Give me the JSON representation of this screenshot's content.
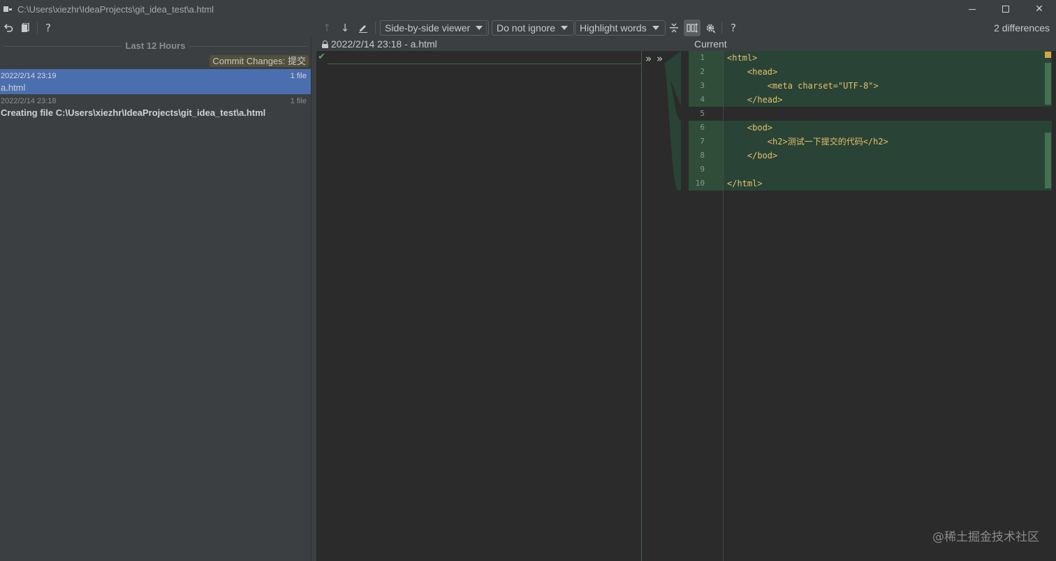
{
  "window": {
    "title": "C:\\Users\\xiezhr\\IdeaProjects\\git_idea_test\\a.html",
    "minimize": "",
    "maximize": "",
    "close": "✕"
  },
  "toolbar": {
    "revert_icon": "arrow-undo-icon",
    "history_icon": "document-icon",
    "help_label": "?",
    "prev_diff_icon": "↑",
    "next_diff_icon": "↓",
    "edit_icon": "pencil-icon",
    "viewer_label": "Side-by-side viewer",
    "ignore_label": "Do not ignore",
    "highlight_label": "Highlight words",
    "collapse_icon": "collapse-unchanged-icon",
    "sync_scroll_icon": "sync-scroll-icon",
    "settings_icon": "gear-icon",
    "help2_label": "?",
    "differences": "2 differences"
  },
  "history": {
    "group_title": "Last 12 Hours",
    "tag": "Commit Changes: 提交",
    "revisions": [
      {
        "date": "2022/2/14 23:19",
        "count": "1 file",
        "message": "a.html",
        "selected": true
      },
      {
        "date": "2022/2/14 23:18",
        "count": "1 file",
        "message": "Creating file C:\\Users\\xiezhr\\IdeaProjects\\git_idea_test\\a.html",
        "selected": false
      }
    ]
  },
  "diff": {
    "left_title": "2022/2/14 23:18 - a.html",
    "right_title": "Current",
    "chevrons": "»",
    "line_numbers": [
      "1",
      "2",
      "3",
      "4",
      "5",
      "6",
      "7",
      "8",
      "9",
      "10"
    ],
    "code": [
      "<html>",
      "    <head>",
      "        <meta charset=\"UTF-8\">",
      "    </head>",
      "",
      "    <bod>",
      "        <h2>测试一下提交的代码</h2>",
      "    </bod>",
      "",
      "</html>"
    ]
  },
  "watermark": "@稀土掘金技术社区"
}
